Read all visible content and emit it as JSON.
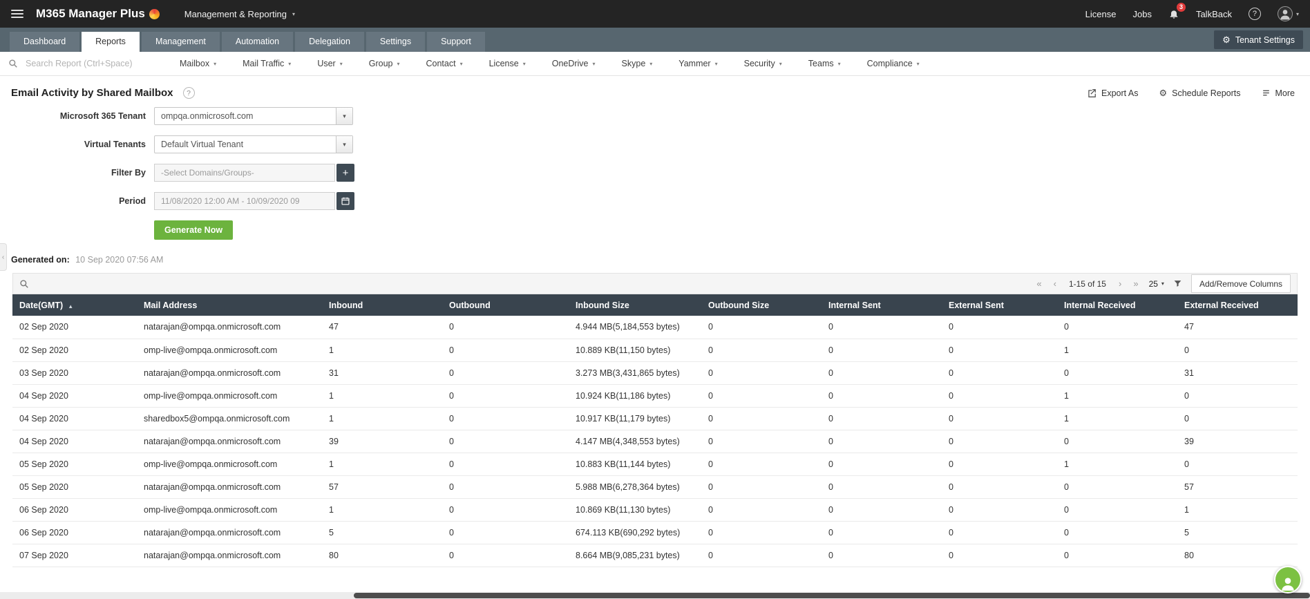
{
  "topbar": {
    "logo": "M365 Manager Plus",
    "module_switcher": "Management & Reporting",
    "license": "License",
    "jobs": "Jobs",
    "notifications_badge": "3",
    "talkback": "TalkBack"
  },
  "tabs": [
    {
      "label": "Dashboard",
      "active": false
    },
    {
      "label": "Reports",
      "active": true
    },
    {
      "label": "Management",
      "active": false
    },
    {
      "label": "Automation",
      "active": false
    },
    {
      "label": "Delegation",
      "active": false
    },
    {
      "label": "Settings",
      "active": false
    },
    {
      "label": "Support",
      "active": false
    }
  ],
  "tenant_settings_button": "Tenant Settings",
  "menubar": {
    "search_placeholder": "Search Report (Ctrl+Space)",
    "menus": [
      "Mailbox",
      "Mail Traffic",
      "User",
      "Group",
      "Contact",
      "License",
      "OneDrive",
      "Skype",
      "Yammer",
      "Security",
      "Teams",
      "Compliance"
    ]
  },
  "page": {
    "title": "Email Activity by Shared Mailbox",
    "export_as": "Export As",
    "schedule_reports": "Schedule Reports",
    "more": "More"
  },
  "form": {
    "tenant_label": "Microsoft 365 Tenant",
    "tenant_value": "ompqa.onmicrosoft.com",
    "virtual_tenants_label": "Virtual Tenants",
    "virtual_tenants_value": "Default Virtual Tenant",
    "filter_by_label": "Filter By",
    "filter_by_placeholder": "-Select Domains/Groups-",
    "period_label": "Period",
    "period_value": "11/08/2020 12:00 AM - 10/09/2020 09",
    "generate_button": "Generate Now"
  },
  "generated": {
    "label": "Generated on:",
    "value": "10 Sep 2020 07:56 AM"
  },
  "table_toolbar": {
    "pagination": "1-15 of 15",
    "page_size": "25",
    "add_remove_columns": "Add/Remove Columns"
  },
  "table": {
    "columns": [
      "Date(GMT)",
      "Mail Address",
      "Inbound",
      "Outbound",
      "Inbound Size",
      "Outbound Size",
      "Internal Sent",
      "External Sent",
      "Internal Received",
      "External Received"
    ],
    "rows": [
      [
        "02 Sep 2020",
        "natarajan@ompqa.onmicrosoft.com",
        "47",
        "0",
        "4.944 MB(5,184,553 bytes)",
        "0",
        "0",
        "0",
        "0",
        "47"
      ],
      [
        "02 Sep 2020",
        "omp-live@ompqa.onmicrosoft.com",
        "1",
        "0",
        "10.889 KB(11,150 bytes)",
        "0",
        "0",
        "0",
        "1",
        "0"
      ],
      [
        "03 Sep 2020",
        "natarajan@ompqa.onmicrosoft.com",
        "31",
        "0",
        "3.273 MB(3,431,865 bytes)",
        "0",
        "0",
        "0",
        "0",
        "31"
      ],
      [
        "04 Sep 2020",
        "omp-live@ompqa.onmicrosoft.com",
        "1",
        "0",
        "10.924 KB(11,186 bytes)",
        "0",
        "0",
        "0",
        "1",
        "0"
      ],
      [
        "04 Sep 2020",
        "sharedbox5@ompqa.onmicrosoft.com",
        "1",
        "0",
        "10.917 KB(11,179 bytes)",
        "0",
        "0",
        "0",
        "1",
        "0"
      ],
      [
        "04 Sep 2020",
        "natarajan@ompqa.onmicrosoft.com",
        "39",
        "0",
        "4.147 MB(4,348,553 bytes)",
        "0",
        "0",
        "0",
        "0",
        "39"
      ],
      [
        "05 Sep 2020",
        "omp-live@ompqa.onmicrosoft.com",
        "1",
        "0",
        "10.883 KB(11,144 bytes)",
        "0",
        "0",
        "0",
        "1",
        "0"
      ],
      [
        "05 Sep 2020",
        "natarajan@ompqa.onmicrosoft.com",
        "57",
        "0",
        "5.988 MB(6,278,364 bytes)",
        "0",
        "0",
        "0",
        "0",
        "57"
      ],
      [
        "06 Sep 2020",
        "omp-live@ompqa.onmicrosoft.com",
        "1",
        "0",
        "10.869 KB(11,130 bytes)",
        "0",
        "0",
        "0",
        "0",
        "1"
      ],
      [
        "06 Sep 2020",
        "natarajan@ompqa.onmicrosoft.com",
        "5",
        "0",
        "674.113 KB(690,292 bytes)",
        "0",
        "0",
        "0",
        "0",
        "5"
      ],
      [
        "07 Sep 2020",
        "natarajan@ompqa.onmicrosoft.com",
        "80",
        "0",
        "8.664 MB(9,085,231 bytes)",
        "0",
        "0",
        "0",
        "0",
        "80"
      ]
    ]
  },
  "icons": {
    "caret_down": "▾",
    "help": "?",
    "plus": "+",
    "first_page": "«",
    "prev_page": "‹",
    "next_page": "›",
    "last_page": "»",
    "sort_asc": "▲",
    "gear": "⚙",
    "collapse_left": "‹"
  },
  "colors": {
    "accent_green": "#6cb33e",
    "topbar_dark": "#242424",
    "tabbar": "#57666f",
    "table_header": "#39444e",
    "badge_red": "#e23b3b"
  }
}
